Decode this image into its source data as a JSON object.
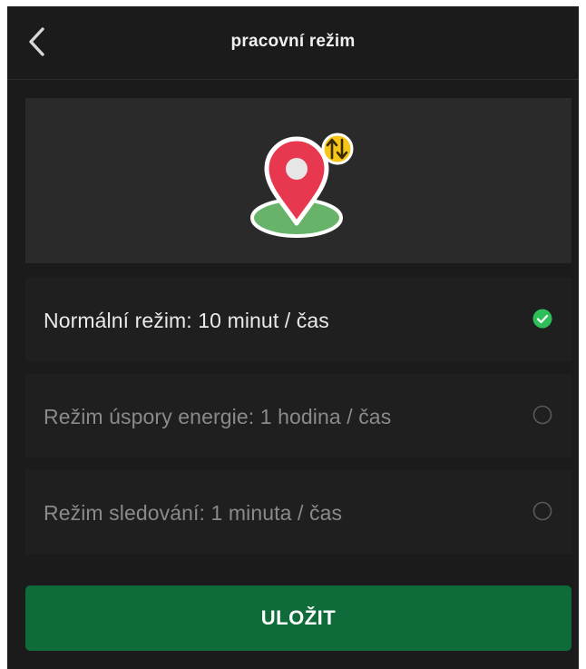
{
  "header": {
    "title": "pracovní režim",
    "back_icon": "chevron-left-icon"
  },
  "banner": {
    "icon": "location-pin-updown-icon"
  },
  "modes": [
    {
      "label": "Normální režim: 10 minut / čas",
      "selected": true
    },
    {
      "label": "Režim úspory energie: 1 hodina / čas",
      "selected": false
    },
    {
      "label": "Režim sledování: 1 minuta / čas",
      "selected": false
    }
  ],
  "actions": {
    "save_label": "ULOŽIT"
  },
  "colors": {
    "background": "#1b1b1b",
    "card": "#2a2a2a",
    "accent_green": "#0f6b3a",
    "check_green": "#2fbf5a",
    "pin_red": "#e8384f",
    "ground_green": "#67b36a",
    "badge_yellow": "#f5c518"
  }
}
